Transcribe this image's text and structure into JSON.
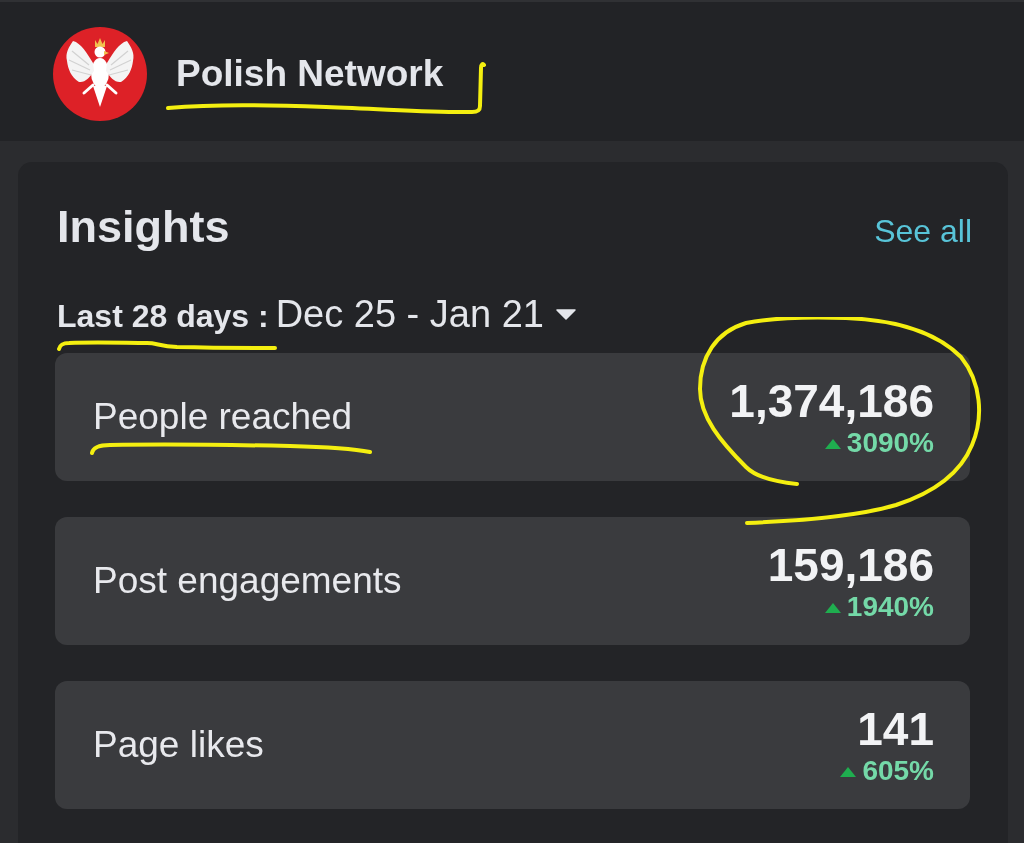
{
  "header": {
    "page_name": "Polish Network",
    "underlined": true
  },
  "insights": {
    "title": "Insights",
    "see_all": "See all",
    "date_range": {
      "label": "Last 28 days :",
      "value": "Dec 25 - Jan 21",
      "label_underlined": true
    },
    "metrics": [
      {
        "label": "People reached",
        "value": "1,374,186",
        "change": "3090%",
        "trend_up": true,
        "label_underlined": true,
        "value_circled": true
      },
      {
        "label": "Post engagements",
        "value": "159,186",
        "change": "1940%",
        "trend_up": true,
        "label_underlined": false,
        "value_circled": false
      },
      {
        "label": "Page likes",
        "value": "141",
        "change": "605%",
        "trend_up": true,
        "label_underlined": false,
        "value_circled": false
      }
    ]
  }
}
